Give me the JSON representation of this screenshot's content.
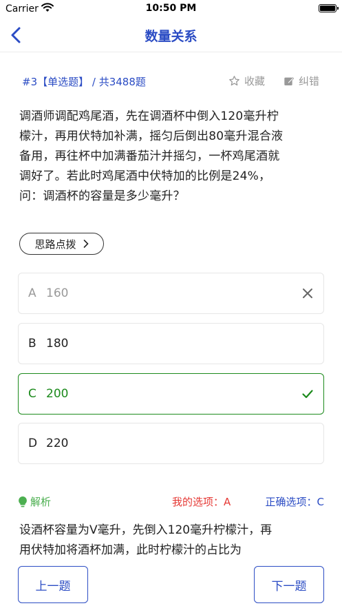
{
  "status_bar": {
    "carrier": "Carrier",
    "time": "10:50 PM"
  },
  "nav": {
    "title": "数量关系"
  },
  "question_header": {
    "id_label": "#3【单选题】",
    "total_label": " / 共3488题",
    "favorite_label": "收藏",
    "correction_label": "纠错"
  },
  "question": {
    "text": "调酒师调配鸡尾酒，先在调酒杯中倒入120毫升柠\n檬汁，再用伏特加补满，摇匀后倒出80毫升混合液\n备用，再往杯中加满番茄汁并摇匀，一杯鸡尾酒就\n调好了。若此时鸡尾酒中伏特加的比例是24%，\n问：调酒杯的容量是多少毫升？"
  },
  "hint_button": {
    "label": "思路点拨"
  },
  "options": [
    {
      "letter": "A",
      "value": "160",
      "state": "wrong"
    },
    {
      "letter": "B",
      "value": "180",
      "state": "normal"
    },
    {
      "letter": "C",
      "value": "200",
      "state": "correct"
    },
    {
      "letter": "D",
      "value": "220",
      "state": "normal"
    }
  ],
  "analysis": {
    "label": "解析",
    "my_answer": "我的选项：A",
    "correct_answer": "正确选项：C",
    "text": "设酒杯容量为V毫升，先倒入120毫升柠檬汁，再\n用伏特加将酒杯加满，此时柠檬汁的占比为"
  },
  "footer": {
    "prev_label": "上一题",
    "next_label": "下一题"
  },
  "colors": {
    "accent": "#2b4cc4",
    "correct": "#1c8a1c",
    "wrong_text": "#999999",
    "my_answer": "#e53935",
    "analysis_label": "#4caf50"
  }
}
